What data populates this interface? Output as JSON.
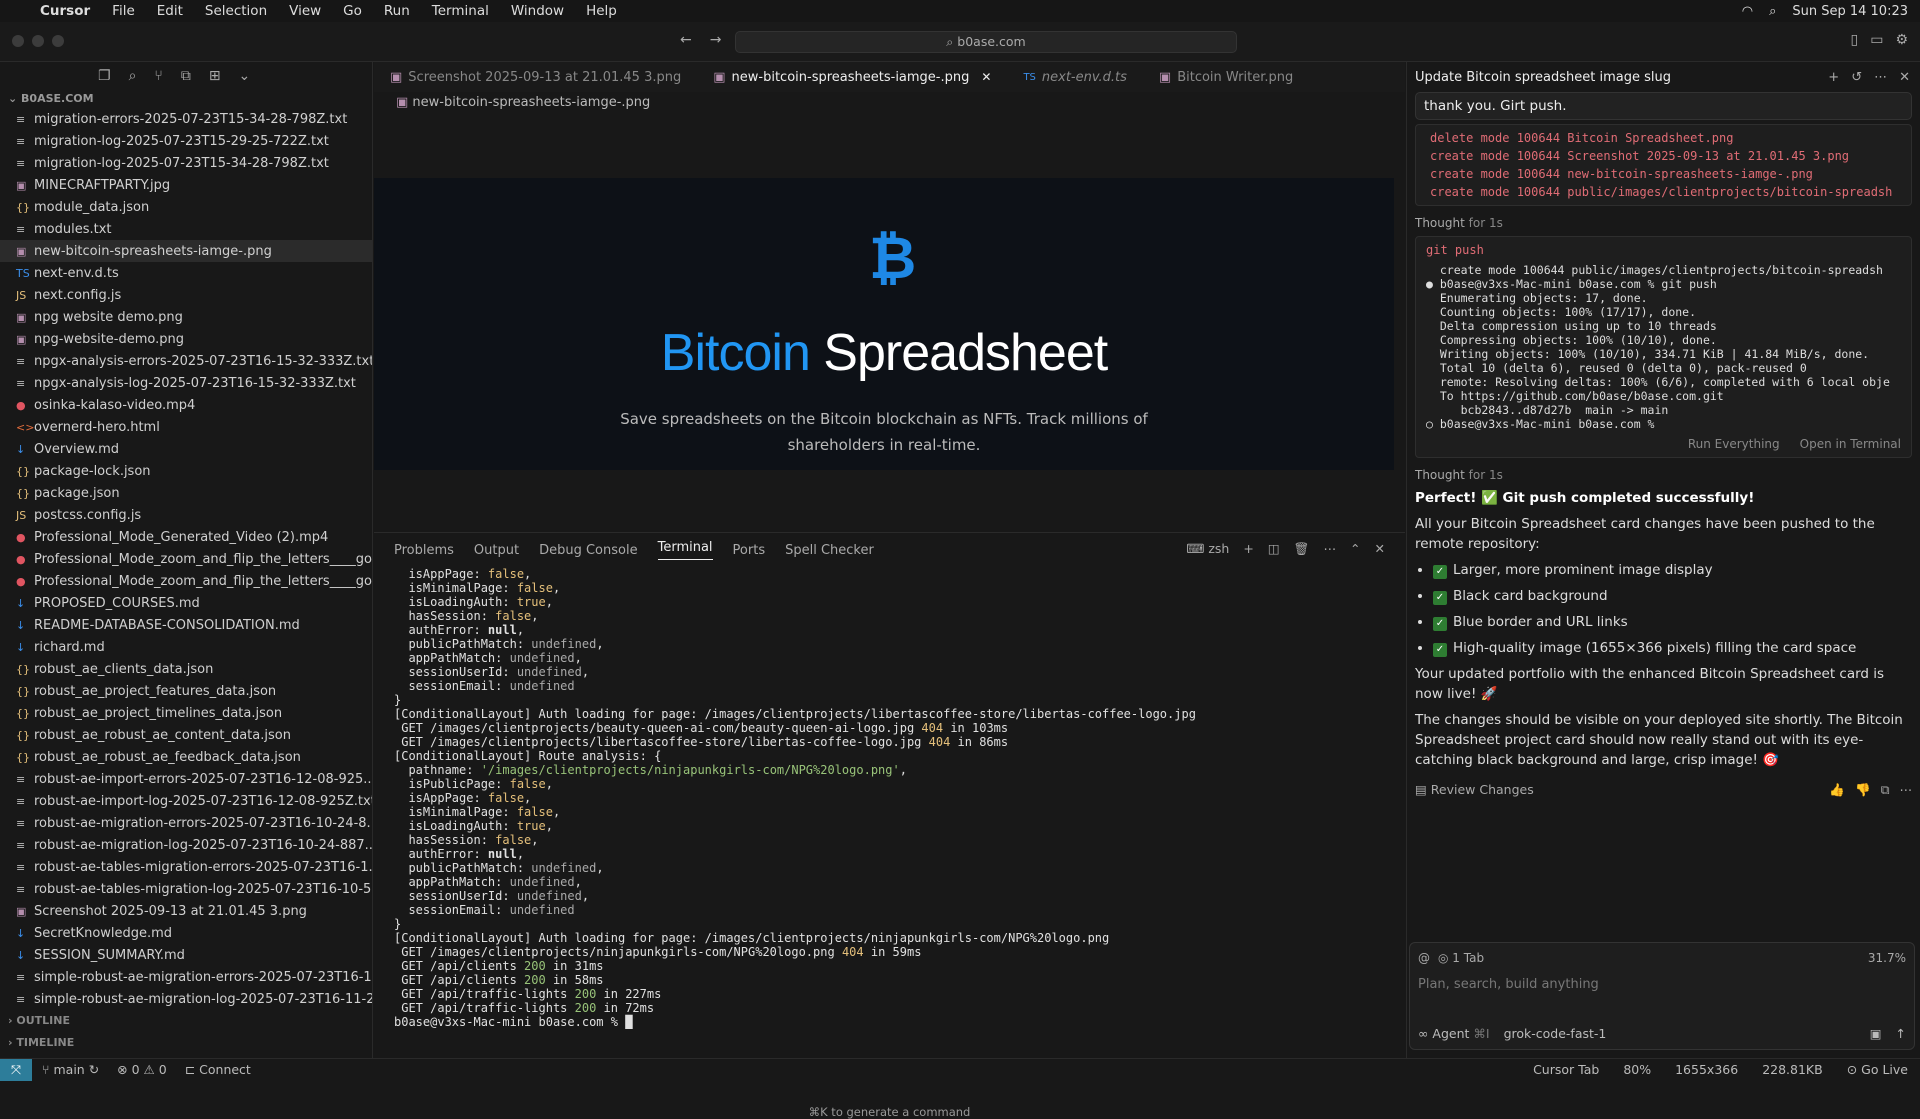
{
  "menubar": {
    "app": "Cursor",
    "items": [
      "File",
      "Edit",
      "Selection",
      "View",
      "Go",
      "Run",
      "Terminal",
      "Window",
      "Help"
    ],
    "clock": "Sun Sep 14  10:23"
  },
  "titlebar": {
    "search": "b0ase.com"
  },
  "sidebar": {
    "root": "B0ASE.COM",
    "files": [
      {
        "name": "migration-errors-2025-07-23T15-34-28-798Z.txt",
        "icon": "≡",
        "color": "#bbb"
      },
      {
        "name": "migration-log-2025-07-23T15-29-25-722Z.txt",
        "icon": "≡",
        "color": "#bbb"
      },
      {
        "name": "migration-log-2025-07-23T15-34-28-798Z.txt",
        "icon": "≡",
        "color": "#bbb"
      },
      {
        "name": "MINECRAFTPARTY.jpg",
        "icon": "▣",
        "color": "#b48ead"
      },
      {
        "name": "module_data.json",
        "icon": "{}",
        "color": "#e5c07b"
      },
      {
        "name": "modules.txt",
        "icon": "≡",
        "color": "#bbb"
      },
      {
        "name": "new-bitcoin-spreasheets-iamge-.png",
        "icon": "▣",
        "color": "#b48ead",
        "active": true
      },
      {
        "name": "next-env.d.ts",
        "icon": "TS",
        "color": "#3b8eea"
      },
      {
        "name": "next.config.js",
        "icon": "JS",
        "color": "#e5c07b"
      },
      {
        "name": "npg website demo.png",
        "icon": "▣",
        "color": "#b48ead"
      },
      {
        "name": "npg-website-demo.png",
        "icon": "▣",
        "color": "#b48ead"
      },
      {
        "name": "npgx-analysis-errors-2025-07-23T16-15-32-333Z.txt",
        "icon": "≡",
        "color": "#bbb"
      },
      {
        "name": "npgx-analysis-log-2025-07-23T16-15-32-333Z.txt",
        "icon": "≡",
        "color": "#bbb"
      },
      {
        "name": "osinka-kalaso-video.mp4",
        "icon": "●",
        "color": "#e05561"
      },
      {
        "name": "overnerd-hero.html",
        "icon": "<>",
        "color": "#e06c3c"
      },
      {
        "name": "Overview.md",
        "icon": "↓",
        "color": "#3b8eea"
      },
      {
        "name": "package-lock.json",
        "icon": "{}",
        "color": "#e5c07b"
      },
      {
        "name": "package.json",
        "icon": "{}",
        "color": "#e5c07b"
      },
      {
        "name": "postcss.config.js",
        "icon": "JS",
        "color": "#e5c07b"
      },
      {
        "name": "Professional_Mode_Generated_Video (2).mp4",
        "icon": "●",
        "color": "#e05561"
      },
      {
        "name": "Professional_Mode_zoom_and_flip_the_letters____go...",
        "icon": "●",
        "color": "#e05561"
      },
      {
        "name": "Professional_Mode_zoom_and_flip_the_letters____go...",
        "icon": "●",
        "color": "#e05561"
      },
      {
        "name": "PROPOSED_COURSES.md",
        "icon": "↓",
        "color": "#3b8eea"
      },
      {
        "name": "README-DATABASE-CONSOLIDATION.md",
        "icon": "↓",
        "color": "#3b8eea"
      },
      {
        "name": "richard.md",
        "icon": "↓",
        "color": "#3b8eea"
      },
      {
        "name": "robust_ae_clients_data.json",
        "icon": "{}",
        "color": "#e5c07b"
      },
      {
        "name": "robust_ae_project_features_data.json",
        "icon": "{}",
        "color": "#e5c07b"
      },
      {
        "name": "robust_ae_project_timelines_data.json",
        "icon": "{}",
        "color": "#e5c07b"
      },
      {
        "name": "robust_ae_robust_ae_content_data.json",
        "icon": "{}",
        "color": "#e5c07b"
      },
      {
        "name": "robust_ae_robust_ae_feedback_data.json",
        "icon": "{}",
        "color": "#e5c07b"
      },
      {
        "name": "robust-ae-import-errors-2025-07-23T16-12-08-925...",
        "icon": "≡",
        "color": "#bbb"
      },
      {
        "name": "robust-ae-import-log-2025-07-23T16-12-08-925Z.txt",
        "icon": "≡",
        "color": "#bbb"
      },
      {
        "name": "robust-ae-migration-errors-2025-07-23T16-10-24-8...",
        "icon": "≡",
        "color": "#bbb"
      },
      {
        "name": "robust-ae-migration-log-2025-07-23T16-10-24-887...",
        "icon": "≡",
        "color": "#bbb"
      },
      {
        "name": "robust-ae-tables-migration-errors-2025-07-23T16-1...",
        "icon": "≡",
        "color": "#bbb"
      },
      {
        "name": "robust-ae-tables-migration-log-2025-07-23T16-10-5...",
        "icon": "≡",
        "color": "#bbb"
      },
      {
        "name": "Screenshot 2025-09-13 at 21.01.45 3.png",
        "icon": "▣",
        "color": "#b48ead"
      },
      {
        "name": "SecretKnowledge.md",
        "icon": "↓",
        "color": "#3b8eea"
      },
      {
        "name": "SESSION_SUMMARY.md",
        "icon": "↓",
        "color": "#3b8eea"
      },
      {
        "name": "simple-robust-ae-migration-errors-2025-07-23T16-1...",
        "icon": "≡",
        "color": "#bbb"
      },
      {
        "name": "simple-robust-ae-migration-log-2025-07-23T16-11-2...",
        "icon": "≡",
        "color": "#bbb"
      }
    ],
    "outline": "OUTLINE",
    "timeline": "TIMELINE"
  },
  "editor": {
    "tabs": [
      "Screenshot 2025-09-13 at 21.01.45 3.png",
      "new-bitcoin-spreasheets-iamge-.png",
      "next-env.d.ts",
      "Bitcoin Writer.png"
    ],
    "breadcrumb": "new-bitcoin-spreasheets-iamge-.png",
    "preview": {
      "logo": "₿",
      "title_blue": "Bitcoin",
      "title_white": " Spreadsheet",
      "subtitle": "Save spreadsheets on the Bitcoin blockchain as NFTs. Track millions of shareholders in real-time."
    }
  },
  "panel": {
    "tabs": [
      "Problems",
      "Output",
      "Debug Console",
      "Terminal",
      "Ports",
      "Spell Checker"
    ],
    "shell": "zsh",
    "hint": "⌘K to generate a command"
  },
  "chat": {
    "title": "Update Bitcoin spreadsheet image slug",
    "user_msg": "thank you. Girt push.",
    "code_lines": [
      "delete mode 100644 Bitcoin Spreadsheet.png",
      "create mode 100644 Screenshot 2025-09-13 at 21.01.45 3.png",
      "create mode 100644 new-bitcoin-spreasheets-iamge-.png",
      "create mode 100644 public/images/clientprojects/bitcoin-spreadsh"
    ],
    "thought1": "Thought",
    "thought1_time": "for 1s",
    "git_cmd": "git push",
    "git_out": "  create mode 100644 public/images/clientprojects/bitcoin-spreadsh\n● b0ase@v3xs-Mac-mini b0ase.com % git push\n  Enumerating objects: 17, done.\n  Counting objects: 100% (17/17), done.\n  Delta compression using up to 10 threads\n  Compressing objects: 100% (10/10), done.\n  Writing objects: 100% (10/10), 334.71 KiB | 41.84 MiB/s, done.\n  Total 10 (delta 6), reused 0 (delta 0), pack-reused 0\n  remote: Resolving deltas: 100% (6/6), completed with 6 local obje\n  To https://github.com/b0ase/b0ase.com.git\n     bcb2843..d87d27b  main -> main\n○ b0ase@v3xs-Mac-mini b0ase.com %",
    "run_everything": "Run Everything",
    "open_terminal": "Open in Terminal",
    "thought2": "Thought",
    "thought2_time": "for 1s",
    "answer_head": "Perfect! ✅ Git push completed successfully!",
    "answer_intro": "All your Bitcoin Spreadsheet card changes have been pushed to the remote repository:",
    "bullets": [
      "Larger, more prominent image display",
      "Black card background",
      "Blue border and URL links",
      "High-quality image (1655×366 pixels) filling the card space"
    ],
    "answer_p2": "Your updated portfolio with the enhanced Bitcoin Spreadsheet card is now live! 🚀",
    "answer_p3": "The changes should be visible on your deployed site shortly. The Bitcoin Spreadsheet project card should now really stand out with its eye-catching black background and large, crisp image! 🎯",
    "review": "Review Changes",
    "input": {
      "tab_ctx": "1 Tab",
      "percent": "31.7%",
      "placeholder": "Plan, search, build anything",
      "mode": "Agent",
      "shortcut": "⌘I",
      "model": "grok-code-fast-1"
    }
  },
  "status": {
    "branch": "main",
    "problems": "⊗ 0 ⚠ 0",
    "connect": "Connect",
    "cursor_tab": "Cursor Tab",
    "zoom": "80%",
    "dims": "1655x366",
    "size": "228.81KB",
    "golive": "Go Live"
  }
}
